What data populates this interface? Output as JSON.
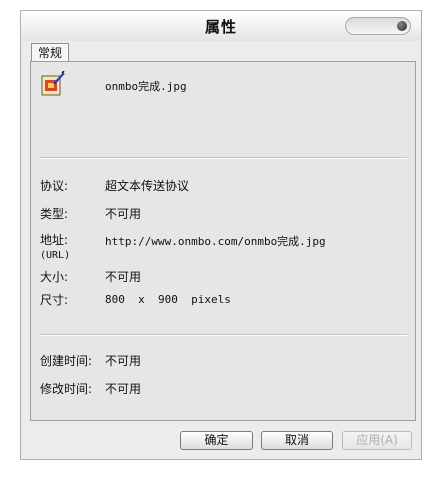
{
  "window": {
    "title": "属性"
  },
  "tabs": [
    {
      "label": "常规"
    }
  ],
  "file": {
    "name": "onmbo完成.jpg",
    "icon": "image-file-icon"
  },
  "properties": [
    {
      "label": "协议:",
      "value": "超文本传送协议"
    },
    {
      "label": "类型:",
      "value": "不可用"
    },
    {
      "label": "地址:",
      "sublabel": "(URL)",
      "value": "http://www.onmbo.com/onmbo完成.jpg"
    },
    {
      "label": "大小:",
      "value": "不可用"
    },
    {
      "label": "尺寸:",
      "value": "800  x  900  pixels"
    }
  ],
  "times": [
    {
      "label": "创建时间:",
      "value": "不可用"
    },
    {
      "label": "修改时间:",
      "value": "不可用"
    }
  ],
  "buttons": {
    "ok": "确定",
    "cancel": "取消",
    "apply": "应用(A)"
  }
}
